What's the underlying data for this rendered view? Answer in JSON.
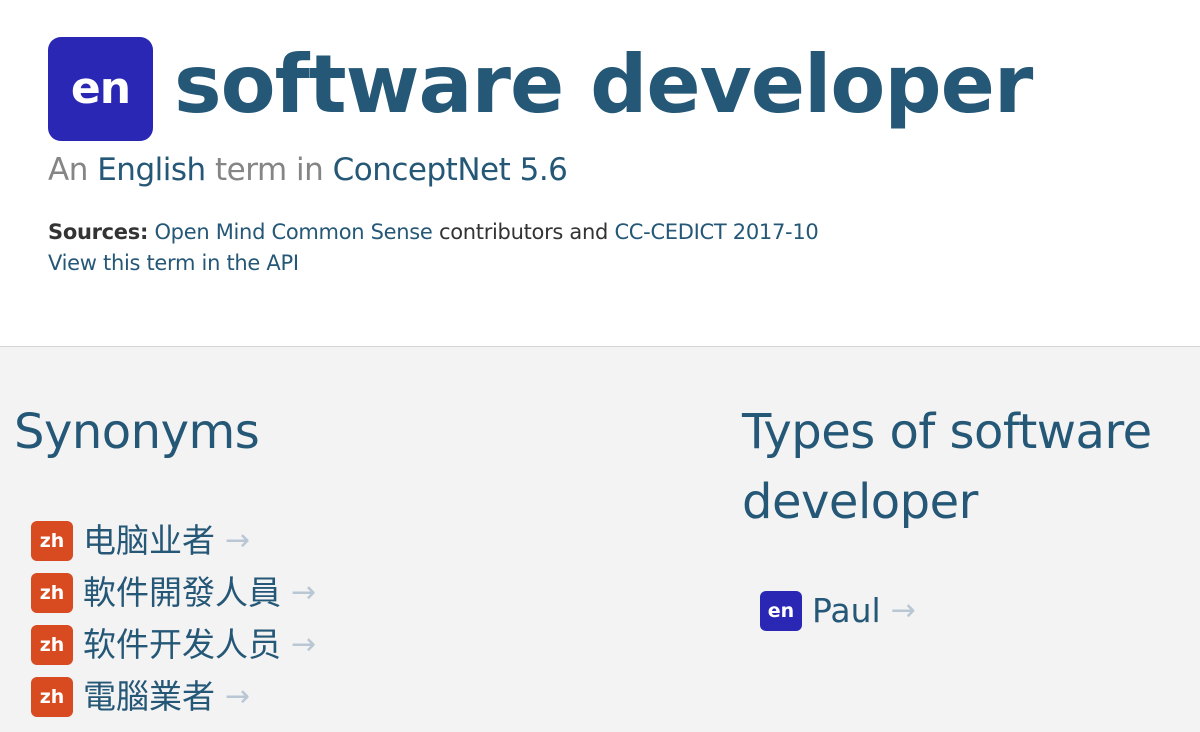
{
  "term": {
    "lang_code": "en",
    "title": "software developer"
  },
  "subtitle": {
    "prefix": "An",
    "language": "English",
    "middle": "term in",
    "project": "ConceptNet 5.6"
  },
  "sources": {
    "label": "Sources:",
    "source1": "Open Mind Common Sense",
    "text1": "contributors and",
    "source2": "CC-CEDICT 2017-10"
  },
  "api_link": "View this term in the API",
  "sections": {
    "synonyms": {
      "heading": "Synonyms",
      "items": [
        {
          "lang": "zh",
          "term": "电脑业者"
        },
        {
          "lang": "zh",
          "term": "軟件開發人員"
        },
        {
          "lang": "zh",
          "term": "软件开发人员"
        },
        {
          "lang": "zh",
          "term": "電腦業者"
        }
      ]
    },
    "types": {
      "heading": "Types of software developer",
      "items": [
        {
          "lang": "en",
          "term": "Paul"
        }
      ]
    }
  },
  "colors": {
    "title_blue": "#255777",
    "badge_en": "#2b27b5",
    "badge_zh": "#d84b20",
    "arrow": "#b9c7d4",
    "content_bg": "#f3f3f3"
  },
  "icons": {
    "arrow": "→"
  }
}
